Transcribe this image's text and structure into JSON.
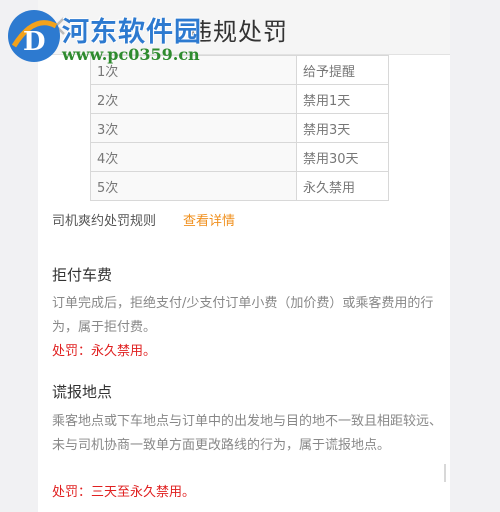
{
  "header": {
    "title": "违规处罚",
    "back_icon": "chevron-left-icon"
  },
  "watermark": {
    "name": "河东软件园",
    "url": "www.pc0359.cn"
  },
  "table": {
    "rows": [
      {
        "count": "1次",
        "penalty": "给予提醒"
      },
      {
        "count": "2次",
        "penalty": "禁用1天"
      },
      {
        "count": "3次",
        "penalty": "禁用3天"
      },
      {
        "count": "4次",
        "penalty": "禁用30天"
      },
      {
        "count": "5次",
        "penalty": "永久禁用"
      }
    ]
  },
  "rules": {
    "label": "司机爽约处罚规则",
    "link": "查看详情"
  },
  "sections": [
    {
      "heading": "拒付车费",
      "description": "订单完成后，拒绝支付/少支付订单小费（加价费）或乘客费用的行为，属于拒付费。",
      "penalty": "处罚：永久禁用。"
    },
    {
      "heading": "谎报地点",
      "description": "乘客地点或下车地点与订单中的出发地与目的地不一致且相距较远、未与司机协商一致单方面更改路线的行为，属于谎报地点。",
      "penalty": "处罚：三天至永久禁用。"
    }
  ],
  "colors": {
    "accent_link": "#f0901e",
    "penalty_red": "#e02020",
    "watermark_blue": "#2d7ad0",
    "watermark_green": "#2e8b2e"
  }
}
